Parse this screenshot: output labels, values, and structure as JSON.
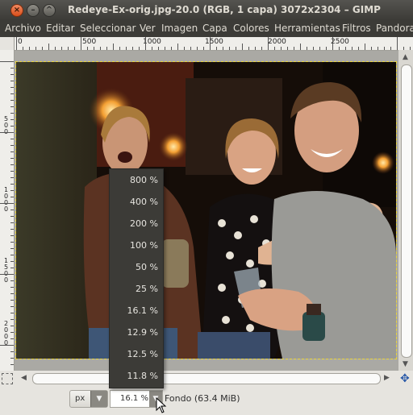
{
  "window": {
    "title": "Redeye-Ex-orig.jpg-20.0 (RGB, 1 capa) 3072x2304 – GIMP",
    "buttons": {
      "close": "close-icon",
      "minimize": "minimize-icon",
      "maximize": "maximize-icon"
    }
  },
  "menubar": {
    "items": [
      "Archivo",
      "Editar",
      "Seleccionar",
      "Ver",
      "Imagen",
      "Capa",
      "Colores",
      "Herramientas",
      "Filtros",
      "Pandora"
    ]
  },
  "rulers": {
    "top": [
      "0",
      "500",
      "1000",
      "1500",
      "2000",
      "2500"
    ],
    "left": [
      "5\n0\n0",
      "1\n0\n0\n0",
      "1\n5\n0\n0",
      "2\n0\n0\n0"
    ]
  },
  "zoom_menu": {
    "options": [
      "800 %",
      "400 %",
      "200 %",
      "100 %",
      "50 %",
      "25 %",
      "16.1 %",
      "12.9 %",
      "12.5 %",
      "11.8 %"
    ]
  },
  "statusbar": {
    "unit": "px",
    "zoom": "16.1 %",
    "layer_info": "Fondo (63.4 MiB)"
  },
  "colors": {
    "titlebar": "#3c3b37",
    "menu_bg": "#3c3b37",
    "menu_text": "#dfdbd2",
    "accent_close": "#e05a24"
  }
}
